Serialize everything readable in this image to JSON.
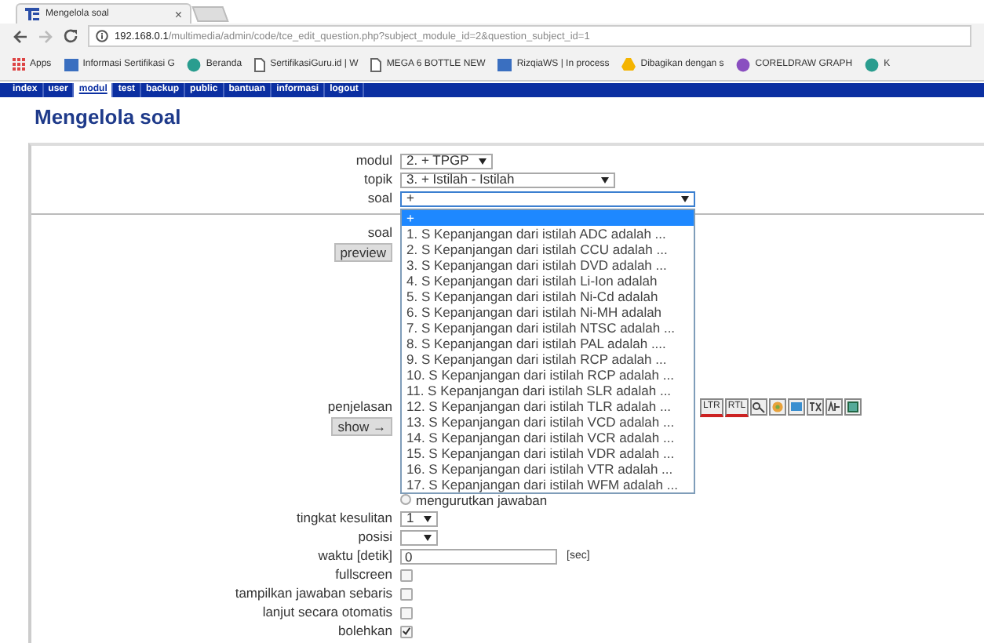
{
  "browser": {
    "tab_title": "Mengelola soal",
    "tab_close": "×",
    "url_host": "192.168.0.1",
    "url_path": "/multimedia/admin/code/tce_edit_question.php?subject_module_id=2&question_subject_id=1",
    "bookmarks": [
      {
        "kind": "apps",
        "label": "Apps"
      },
      {
        "kind": "site",
        "label": "Informasi Sertifikasi G"
      },
      {
        "kind": "globe",
        "label": "Beranda"
      },
      {
        "kind": "page",
        "label": "SertifikasiGuru.id | W"
      },
      {
        "kind": "page",
        "label": "MEGA 6 BOTTLE NEW"
      },
      {
        "kind": "site",
        "label": "RizqiaWS | In process"
      },
      {
        "kind": "drive",
        "label": "Dibagikan dengan s"
      },
      {
        "kind": "corel",
        "label": "CORELDRAW GRAPH"
      },
      {
        "kind": "globe",
        "label": "K"
      }
    ]
  },
  "nav": [
    {
      "label": "index",
      "selected": false
    },
    {
      "label": "user",
      "selected": false
    },
    {
      "label": "modul",
      "selected": true
    },
    {
      "label": "test",
      "selected": false
    },
    {
      "label": "backup",
      "selected": false
    },
    {
      "label": "public",
      "selected": false
    },
    {
      "label": "bantuan",
      "selected": false
    },
    {
      "label": "informasi",
      "selected": false
    },
    {
      "label": "logout",
      "selected": false
    }
  ],
  "title": "Mengelola soal",
  "selectors": [
    {
      "label": "modul",
      "value": "2. + TPGP",
      "open": false
    },
    {
      "label": "topik",
      "value": "3. + Istilah - Istilah",
      "open": false
    },
    {
      "label": "soal",
      "value": "+",
      "open": true
    }
  ],
  "dropdown_options": [
    {
      "label": "+",
      "selected": true
    },
    {
      "label": "1. S Kepanjangan dari istilah ADC adalah ...",
      "selected": false
    },
    {
      "label": "2. S Kepanjangan dari istilah CCU adalah ...",
      "selected": false
    },
    {
      "label": "3. S Kepanjangan dari istilah DVD adalah ...",
      "selected": false
    },
    {
      "label": "4. S Kepanjangan dari istilah Li-Ion adalah",
      "selected": false
    },
    {
      "label": "5. S Kepanjangan dari istilah Ni-Cd adalah",
      "selected": false
    },
    {
      "label": "6. S Kepanjangan dari istilah Ni-MH adalah",
      "selected": false
    },
    {
      "label": "7. S Kepanjangan dari istilah NTSC adalah ...",
      "selected": false
    },
    {
      "label": "8. S Kepanjangan dari istilah PAL adalah ....",
      "selected": false
    },
    {
      "label": "9. S Kepanjangan dari istilah RCP adalah ...",
      "selected": false
    },
    {
      "label": "10. S Kepanjangan dari istilah RCP adalah ...",
      "selected": false
    },
    {
      "label": "11. S Kepanjangan dari istilah SLR adalah ...",
      "selected": false
    },
    {
      "label": "12. S Kepanjangan dari istilah TLR adalah ...",
      "selected": false
    },
    {
      "label": "13. S Kepanjangan dari istilah VCD adalah ...",
      "selected": false
    },
    {
      "label": "14. S Kepanjangan dari istilah VCR adalah ...",
      "selected": false
    },
    {
      "label": "15. S Kepanjangan dari istilah VDR adalah ...",
      "selected": false
    },
    {
      "label": "16. S Kepanjangan dari istilah VTR adalah ...",
      "selected": false
    },
    {
      "label": "17. S Kepanjangan dari istilah WFM adalah ...",
      "selected": false
    }
  ],
  "editor": {
    "label": "soal",
    "button": "preview",
    "toolbar": [
      {
        "kind": "text",
        "label": "LTR"
      },
      {
        "kind": "text",
        "label": "RTL"
      },
      {
        "kind": "icon"
      },
      {
        "kind": "icon"
      },
      {
        "kind": "icon"
      },
      {
        "kind": "icon"
      },
      {
        "kind": "icon"
      },
      {
        "kind": "icon"
      }
    ]
  },
  "explanation": {
    "label": "penjelasan",
    "button": "show →"
  },
  "radio": {
    "label": "mengurutkan jawaban",
    "checked": false
  },
  "fields": [
    {
      "kind": "select",
      "label": "tingkat kesulitan",
      "value": "1"
    },
    {
      "kind": "select",
      "label": "posisi"
    },
    {
      "kind": "text",
      "label": "waktu [detik]",
      "value": "0",
      "unit": "[sec]"
    },
    {
      "kind": "checkbox",
      "label": "fullscreen",
      "checked": false
    },
    {
      "kind": "checkbox",
      "label": "tampilkan jawaban sebaris",
      "checked": false
    },
    {
      "kind": "checkbox",
      "label": "lanjut secara otomatis",
      "checked": false
    },
    {
      "kind": "checkbox",
      "label": "bolehkan",
      "checked": true
    }
  ]
}
